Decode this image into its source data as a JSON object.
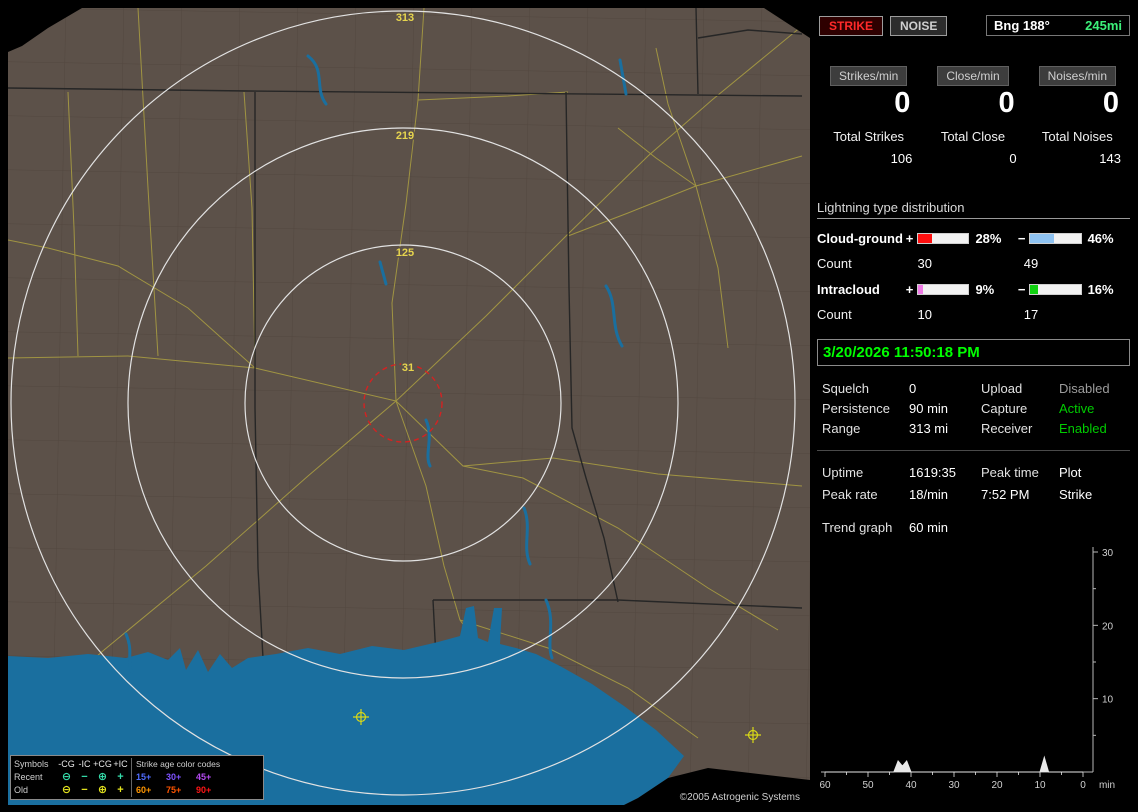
{
  "map": {
    "copyright": "©2005 Astrogenic Systems",
    "ring_labels": [
      "313",
      "219",
      "125",
      "31"
    ],
    "legend": {
      "symbols_header": "Symbols",
      "symbol_columns": [
        "-CG",
        "-IC",
        "+CG",
        "+IC"
      ],
      "age_header": "Strike age color codes",
      "rows": [
        {
          "label": "Recent",
          "symbols": [
            "⊖",
            "−",
            "⊕",
            "+"
          ],
          "symbol_color": "#35dcaa",
          "ages": [
            "15+",
            "30+",
            "45+"
          ],
          "age_colors": [
            "#4f6cff",
            "#7e52ff",
            "#b44af0"
          ]
        },
        {
          "label": "Old",
          "symbols": [
            "⊖",
            "−",
            "⊕",
            "+"
          ],
          "symbol_color": "#e4e41e",
          "ages": [
            "60+",
            "75+",
            "90+"
          ],
          "age_colors": [
            "#ff9500",
            "#ff5500",
            "#ff1515"
          ]
        }
      ]
    }
  },
  "toolbar": {
    "strike_button": "STRIKE",
    "noise_button": "NOISE",
    "bearing": "Bng 188°",
    "bearing_range": "245mi"
  },
  "rates": [
    {
      "label": "Strikes/min",
      "value": "0",
      "total_label": "Total Strikes",
      "total_value": "106"
    },
    {
      "label": "Close/min",
      "value": "0",
      "total_label": "Total Close",
      "total_value": "0"
    },
    {
      "label": "Noises/min",
      "value": "0",
      "total_label": "Total Noises",
      "total_value": "143"
    }
  ],
  "distribution": {
    "title": "Lightning type distribution",
    "count_label": "Count",
    "rows": [
      {
        "label": "Cloud-ground",
        "plus_sign": "+",
        "minus_sign": "−",
        "plus_pct": "28%",
        "plus_width": 28,
        "plus_color": "#ff1010",
        "minus_pct": "46%",
        "minus_width": 46,
        "minus_color": "#8fc3f2",
        "plus_count": "30",
        "minus_count": "49"
      },
      {
        "label": "Intracloud",
        "plus_sign": "+",
        "minus_sign": "−",
        "plus_pct": "9%",
        "plus_width": 9,
        "plus_color": "#f07ae6",
        "minus_pct": "16%",
        "minus_width": 16,
        "minus_color": "#10d010",
        "plus_count": "10",
        "minus_count": "17"
      }
    ]
  },
  "clock": "3/20/2026 11:50:18 PM",
  "settings_rows": [
    {
      "label": "Squelch",
      "value": "0",
      "label2": "Upload",
      "value2": "Disabled",
      "value2_color": "#9c9c9c"
    },
    {
      "label": "Persistence",
      "value": "90 min",
      "label2": "Capture",
      "value2": "Active",
      "value2_color": "#00cc00"
    },
    {
      "label": "Range",
      "value": "313 mi",
      "label2": "Receiver",
      "value2": "Enabled",
      "value2_color": "#00cc00"
    }
  ],
  "session_rows": [
    {
      "c1": "Uptime",
      "c2": "1619:35",
      "c3": "Peak time",
      "c4": "Plot"
    },
    {
      "c1": "Peak rate",
      "c2": "18/min",
      "c3": "7:52 PM",
      "c4": "Strike"
    }
  ],
  "trend": {
    "label": "Trend graph",
    "value": "60 min"
  },
  "chart_data": {
    "type": "line",
    "title": "Trend graph (strike rate, last 60 minutes)",
    "x_unit": "min",
    "x_ticks": [
      60,
      50,
      40,
      30,
      20,
      10,
      0
    ],
    "y_ticks": [
      10,
      20,
      30
    ],
    "ylim": [
      0,
      30
    ],
    "x_range_minutes": [
      60,
      0
    ],
    "legend_position": "none",
    "grid": false,
    "series": [
      {
        "name": "Strike",
        "values_by_minute": {
          "43": 1.5,
          "42": 0.8,
          "41": 1.5,
          "9": 2
        }
      }
    ]
  }
}
